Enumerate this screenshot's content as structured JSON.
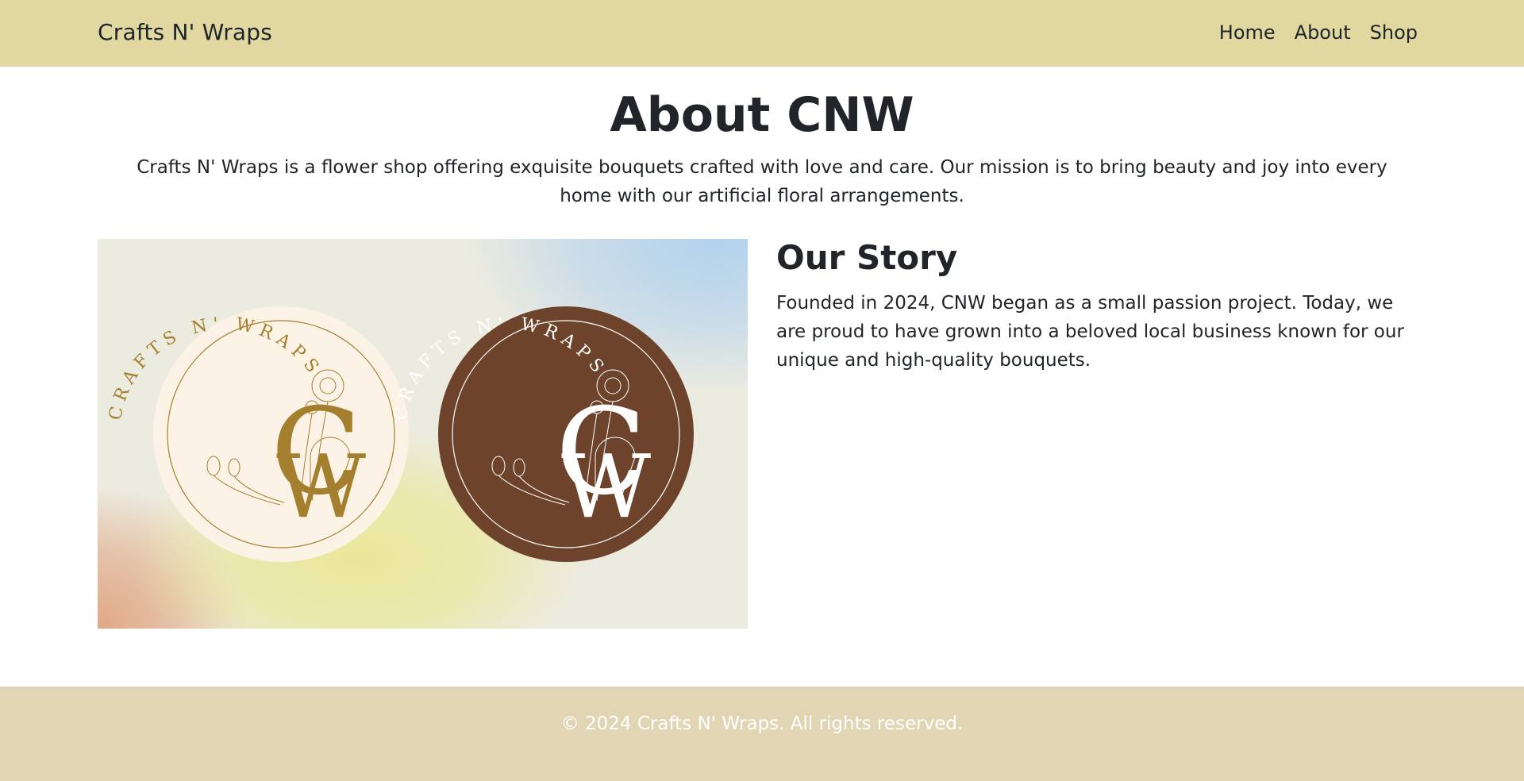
{
  "nav": {
    "brand": "Crafts N' Wraps",
    "links": [
      "Home",
      "About",
      "Shop"
    ]
  },
  "hero": {
    "title": "About CNW",
    "intro": "Crafts N' Wraps is a flower shop offering exquisite bouquets crafted with love and care. Our mission is to bring beauty and joy into every home with our artificial floral arrangements."
  },
  "logos": {
    "curved_text": "CRAFTS N' WRAPS",
    "monogram_c": "C",
    "monogram_w": "W",
    "light_badge": {
      "background": "#fcf3e6",
      "ink": "#a47f2e"
    },
    "dark_badge": {
      "background": "#6d432b",
      "ink": "#ffffff"
    }
  },
  "story": {
    "title": "Our Story",
    "text": "Founded in 2024, CNW began as a small passion project. Today, we are proud to have grown into a beloved local business known for our unique and high-quality bouquets."
  },
  "footer": {
    "copyright": "© 2024 Crafts N' Wraps. All rights reserved."
  },
  "colors": {
    "navbar": "#e0d8a0",
    "footer": "#e2d5b4",
    "text": "#212529"
  }
}
